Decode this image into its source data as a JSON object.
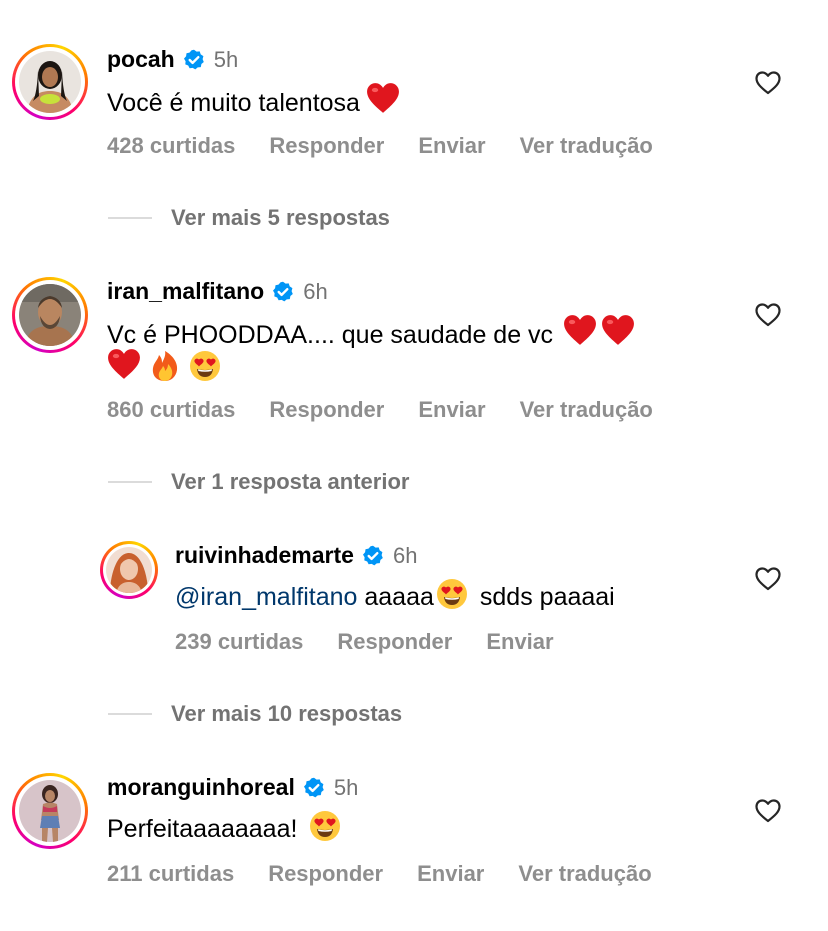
{
  "comments": [
    {
      "username": "pocah",
      "time": "5h",
      "text": "Você é muito talentosa",
      "likes": "428 curtidas",
      "reply": "Responder",
      "send": "Enviar",
      "translate": "Ver tradução"
    },
    {
      "username": "iran_malfitano",
      "time": "6h",
      "text_line1": "Vc é PHOODDAA.... que saudade de vc",
      "likes": "860 curtidas",
      "reply": "Responder",
      "send": "Enviar",
      "translate": "Ver tradução"
    },
    {
      "username": "ruivinhademarte",
      "time": "6h",
      "mention": "@iran_malfitano",
      "text_a": "aaaaa",
      "text_b": "sdds paaaai",
      "likes": "239 curtidas",
      "reply": "Responder",
      "send": "Enviar"
    },
    {
      "username": "moranguinhoreal",
      "time": "5h",
      "text": "Perfeitaaaaaaaa!",
      "likes": "211 curtidas",
      "reply": "Responder",
      "send": "Enviar",
      "translate": "Ver tradução"
    }
  ],
  "view_more_1": "Ver mais 5 respostas",
  "view_previous": "Ver 1 resposta anterior",
  "view_more_2": "Ver mais 10 respostas",
  "icons": {
    "verified": "verified-badge-icon",
    "like": "heart-outline-icon",
    "emojis": [
      "red-heart",
      "fire",
      "heart-eyes-face"
    ]
  },
  "colors": {
    "verified": "#0095f6",
    "secondary_text": "#737373",
    "action_text": "#8e8e8e",
    "mention": "#00376b",
    "divider": "#dbdbdb"
  }
}
